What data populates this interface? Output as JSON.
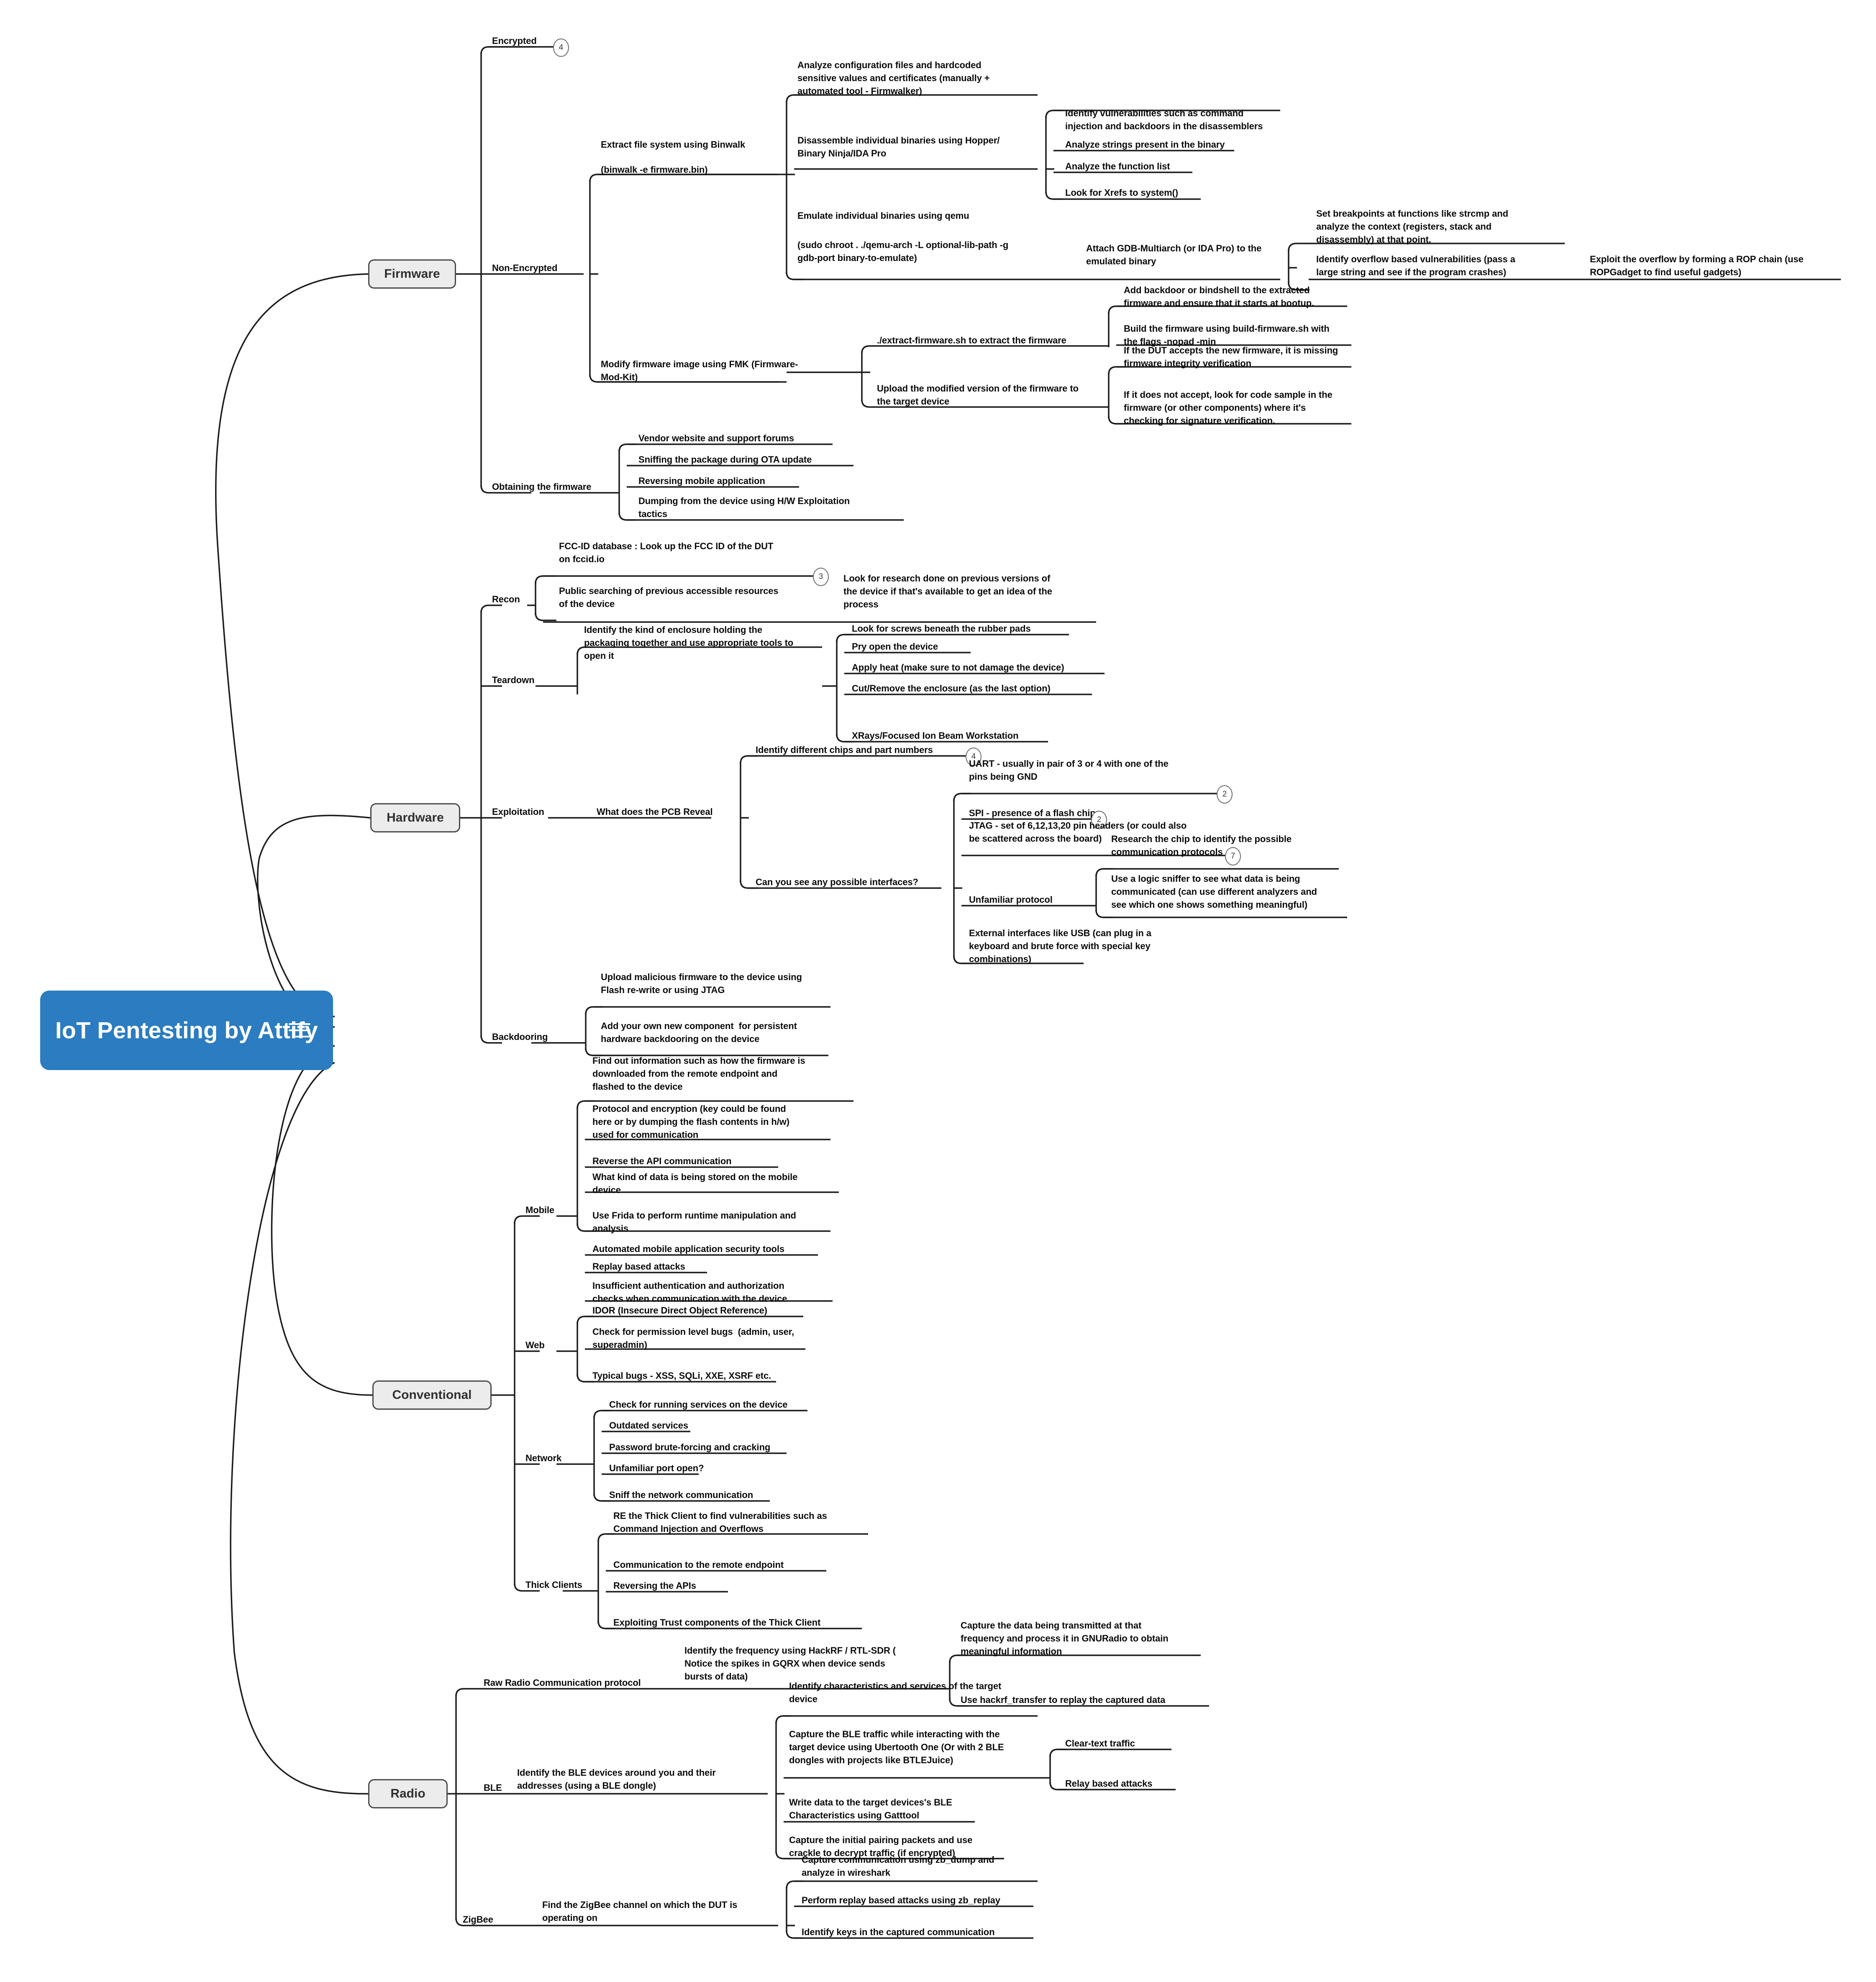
{
  "root": {
    "label": "IoT Pentesting by\nAttify",
    "color": "#2b7cc0",
    "menu_icon": "hamburger-icon"
  },
  "branches": {
    "firmware": {
      "label": "Firmware"
    },
    "hardware": {
      "label": "Hardware"
    },
    "conventional": {
      "label": "Conventional"
    },
    "radio": {
      "label": "Radio"
    }
  },
  "topics": {
    "t001": "Encrypted",
    "t002": "Non-Encrypted",
    "t003": "Extract file system using Binwalk",
    "t004": "(binwalk -e firmware.bin)",
    "t005": "Analyze configuration files and hardcoded\nsensitive values and certificates (manually +\nautomated tool - Firmwalker)",
    "t006": "Disassemble individual binaries using Hopper/\nBinary Ninja/IDA Pro",
    "t007": "Identify vulnerabilities such as command\ninjection and backdoors in the disassemblers",
    "t008": "Analyze strings present in the binary",
    "t009": "Analyze the function list",
    "t010": "Look for Xrefs to system()",
    "t011": "Emulate individual binaries using qemu",
    "t012": "(sudo chroot . ./qemu-arch -L optional-lib-path -g\ngdb-port binary-to-emulate)",
    "t013": "Attach GDB-Multiarch (or IDA Pro) to the\nemulated binary",
    "t014": "Set breakpoints at functions like strcmp and\nanalyze the context (registers, stack and\ndisassembly) at that point.",
    "t015": "Identify overflow based vulnerabilities (pass a\nlarge string and see if the program crashes)",
    "t016": "Exploit the overflow by forming a ROP chain (use\nROPGadget to find useful gadgets)",
    "t017": "Modify firmware image using FMK (Firmware-\nMod-Kit)",
    "t018": "./extract-firmware.sh to extract the firmware",
    "t019": "Add backdoor or bindshell to the extracted\nfirmware and ensure that it starts at bootup.",
    "t020": "Build the firmware using build-firmware.sh with\nthe flags -nopad -min",
    "t021": "Upload the modified version of the firmware to\nthe target device",
    "t022": "If the DUT accepts the new firmware, it is missing\nfirmware integrity verification",
    "t023": "If it does not accept, look for code sample in the\nfirmware (or other components) where it's\nchecking for signature verification.",
    "t024": "Obtaining the firmware",
    "t025": "Vendor website and support forums",
    "t026": "Sniffing the package during OTA update",
    "t027": "Reversing mobile application",
    "t028": "Dumping from the device using H/W Exploitation\ntactics",
    "t029": "Recon",
    "t030": "FCC-ID database : Look up the FCC ID of the DUT\non fccid.io",
    "t031": "Public searching of previous accessible resources\nof the device",
    "t032": "Look for research done on previous versions of\nthe device if that's available to get an idea of the\nprocess",
    "t033": "Teardown",
    "t034": "Identify the kind of enclosure holding the\npackaging together and use appropriate tools to\nopen it",
    "t035": "Look for screws beneath the rubber pads",
    "t036": "Pry open the device",
    "t037": "Apply heat (make sure to not damage the device)",
    "t038": "Cut/Remove the enclosure (as the last option)",
    "t039": "XRays/Focused Ion Beam Workstation",
    "t040": "Exploitation",
    "t041": "What does the PCB Reveal",
    "t042": "Identify different chips and part numbers",
    "t043": "Can you see any possible interfaces?",
    "t044": "UART - usually in pair of 3 or 4 with one of the\npins being GND",
    "t045": "SPI - presence of a flash chip",
    "t046": "JTAG - set of 6,12,13,20 pin headers (or could also\nbe scattered across the board)",
    "t047": "Unfamiliar protocol",
    "t048": "Research the chip to identify the possible\ncommunication protocols",
    "t049": "Use a logic sniffer to see what data is being\ncommunicated (can use different analyzers and\nsee which one shows something meaningful)",
    "t050": "External interfaces like USB (can plug in a\nkeyboard and brute force with special key\ncombinations)",
    "t051": "Backdooring",
    "t052": "Upload malicious firmware to the device using\nFlash re-write or using JTAG",
    "t053": "Add your own new component  for persistent\nhardware backdooring on the device",
    "t054": "Mobile",
    "t055": "Find out information such as how the firmware is\ndownloaded from the remote endpoint and\nflashed to the device",
    "t056": "Protocol and encryption (key could be found\nhere or by dumping the flash contents in h/w)\nused for communication",
    "t057": "Reverse the API communication",
    "t058": "What kind of data is being stored on the mobile\ndevice",
    "t059": "Use Frida to perform runtime manipulation and\nanalysis",
    "t060": "Automated mobile application security tools",
    "t061": "Replay based attacks",
    "t062": "Insufficient authentication and authorization\nchecks when communication with the device",
    "t063": "Web",
    "t064": "IDOR (Insecure Direct Object Reference)",
    "t065": "Check for permission level bugs  (admin, user,\nsuperadmin)",
    "t066": "Typical bugs - XSS, SQLi, XXE, XSRF etc.",
    "t067": "Network",
    "t068": "Check for running services on the device",
    "t069": "Outdated services",
    "t070": "Password brute-forcing and cracking",
    "t071": "Unfamiliar port open?",
    "t072": "Sniff the network communication",
    "t073": "Thick Clients",
    "t074": "RE the Thick Client to find vulnerabilities such as\nCommand Injection and Overflows",
    "t075": "Communication to the remote endpoint",
    "t076": "Reversing the APIs",
    "t077": "Exploiting Trust components of the Thick Client",
    "t078": "Raw Radio Communication protocol",
    "t079": "Identify the frequency using HackRF / RTL-SDR (\nNotice the spikes in GQRX when device sends\nbursts of data)",
    "t080": "Capture the data being transmitted at that\nfrequency and process it in GNURadio to obtain\nmeaningful information",
    "t081": "Use hackrf_transfer to replay the captured data",
    "t082": "BLE",
    "t083": "Identify the BLE devices around you and their\naddresses (using a BLE dongle)",
    "t084": "Identify characteristics and services of the target\ndevice",
    "t085": "Capture the BLE traffic while interacting with the\ntarget device using Ubertooth One (Or with 2 BLE\ndongles with projects like BTLEJuice)",
    "t086": "Clear-text traffic",
    "t087": "Relay based attacks",
    "t088": "Write data to the target devices's BLE\nCharacteristics using Gatttool",
    "t089": "Capture the initial pairing packets and use\ncrackle to decrypt traffic (if encrypted)",
    "t090": "ZigBee",
    "t091": "Find the ZigBee channel on which the DUT is\noperating on",
    "t092": "Capture communication using zb_dump and\nanalyze in wireshark",
    "t093": "Perform replay based attacks using zb_replay",
    "t094": "Identify keys in the captured communication"
  },
  "badges": {
    "b_encrypted": "4",
    "b_fccid": "3",
    "b_chips": "4",
    "b_uart": "2",
    "b_spi": "2",
    "b_jtag": "7"
  }
}
